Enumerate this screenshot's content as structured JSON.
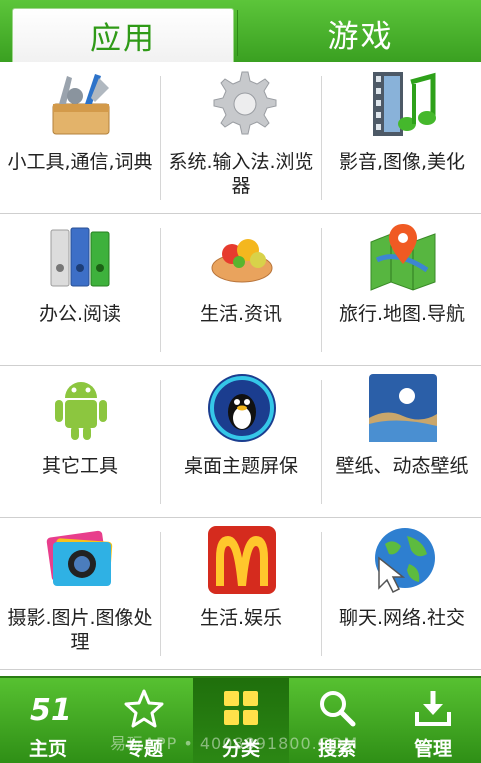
{
  "tabs": {
    "apps": "应用",
    "games": "游戏"
  },
  "categories": [
    {
      "label": "小工具,通信,词典",
      "icon": "toolbox-icon"
    },
    {
      "label": "系统.输入法.浏览器",
      "icon": "gear-icon"
    },
    {
      "label": "影音,图像,美化",
      "icon": "film-music-icon"
    },
    {
      "label": "办公.阅读",
      "icon": "binders-icon"
    },
    {
      "label": "生活.资讯",
      "icon": "fruit-tart-icon"
    },
    {
      "label": "旅行.地图.导航",
      "icon": "map-pin-icon"
    },
    {
      "label": "其它工具",
      "icon": "android-icon"
    },
    {
      "label": "桌面主题屏保",
      "icon": "penguin-icon"
    },
    {
      "label": "壁纸、动态壁纸",
      "icon": "landscape-icon"
    },
    {
      "label": "摄影.图片.图像处理",
      "icon": "camera-icon"
    },
    {
      "label": "生活.娱乐",
      "icon": "mcdonalds-icon"
    },
    {
      "label": "聊天.网络.社交",
      "icon": "globe-cursor-icon"
    }
  ],
  "nav": [
    {
      "label": "主页",
      "icon": "home-logo-icon"
    },
    {
      "label": "专题",
      "icon": "star-icon"
    },
    {
      "label": "分类",
      "icon": "grid-icon"
    },
    {
      "label": "搜索",
      "icon": "search-icon"
    },
    {
      "label": "管理",
      "icon": "download-icon"
    }
  ],
  "watermark": "易玩APP • 4008891800.COM",
  "colors": {
    "accent": "#3aa021",
    "active_tab_text": "#2f9a17"
  }
}
